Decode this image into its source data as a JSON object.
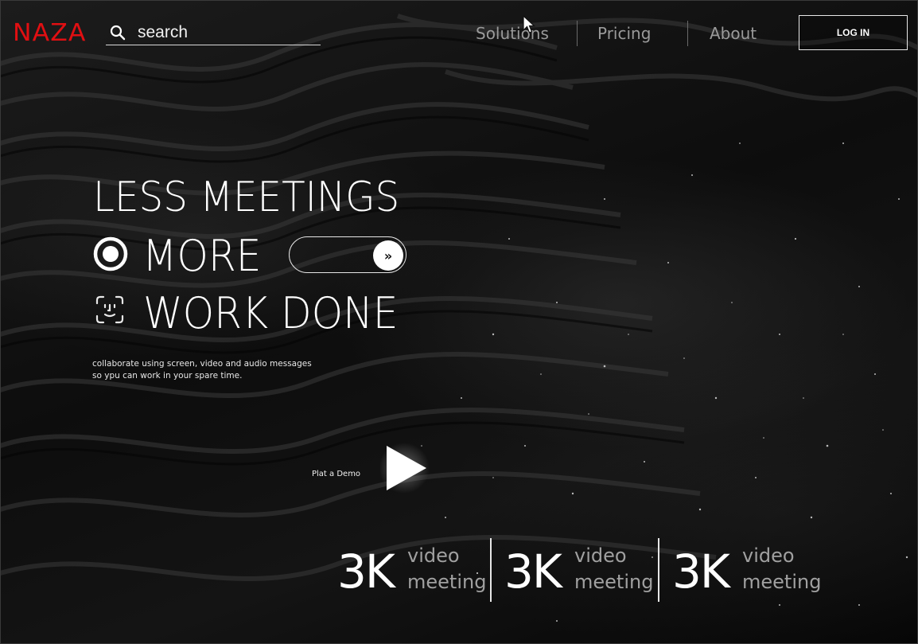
{
  "brand": {
    "logo_text": "NAZA",
    "logo_color": "#e00f12"
  },
  "search": {
    "placeholder": "search",
    "value": ""
  },
  "nav": {
    "items": [
      {
        "label": "Solutions"
      },
      {
        "label": "Pricing"
      },
      {
        "label": "About"
      }
    ],
    "login_label": "LOG IN"
  },
  "hero": {
    "line1": "LESS MEETINGS",
    "line2": "MORE",
    "line3": "WORK DONE",
    "toggle_icon": "»",
    "tagline": "collaborate using screen, video and audio messages so ypu can work in your spare time."
  },
  "demo": {
    "label": "Plat a Demo"
  },
  "stats": [
    {
      "value": "3K",
      "line1": "video",
      "line2": "meeting"
    },
    {
      "value": "3K",
      "line1": "video",
      "line2": "meeting"
    },
    {
      "value": "3K",
      "line1": "video",
      "line2": "meeting"
    }
  ],
  "icons": {
    "search": "search-icon",
    "radio": "radio-selected-icon",
    "face": "face-id-icon",
    "play": "play-icon",
    "chevrons": "double-chevron-right-icon",
    "cursor": "mouse-cursor-icon"
  }
}
